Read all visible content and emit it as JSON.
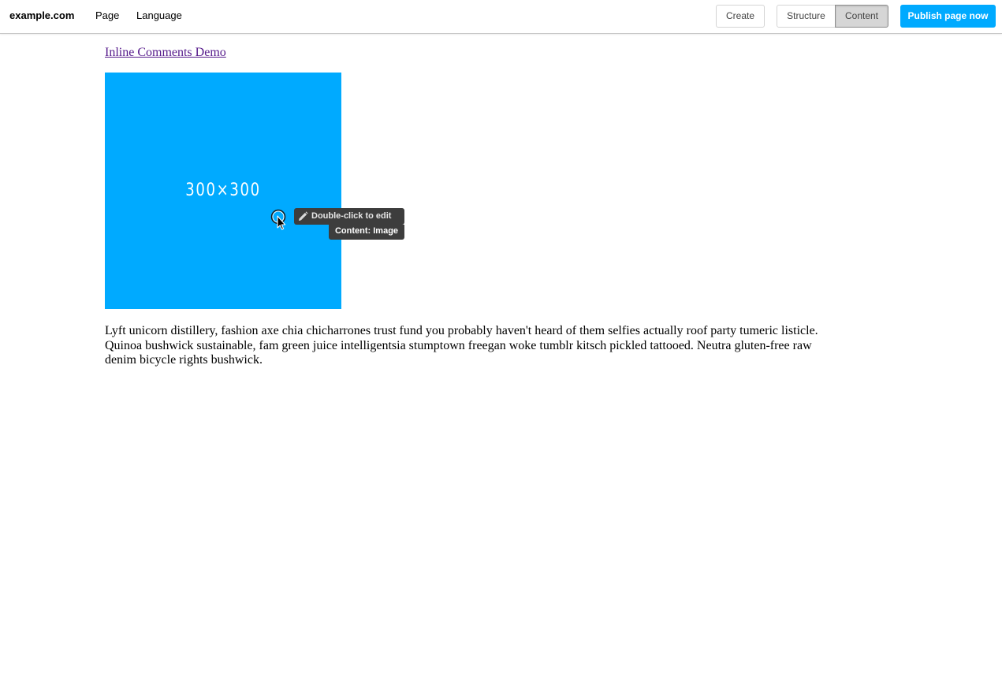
{
  "toolbar": {
    "brand": "example.com",
    "menu": {
      "page": "Page",
      "language": "Language"
    },
    "buttons": {
      "create": "Create",
      "structure": "Structure",
      "content": "Content",
      "publish": "Publish page now"
    },
    "accent_color": "#00aaff"
  },
  "main": {
    "page_link": "Inline Comments Demo",
    "image": {
      "label": "300×300",
      "background_color": "#00aaff"
    },
    "paragraph": "Lyft unicorn distillery, fashion axe chia chicharrones trust fund you probably haven't heard of them selfies actually roof party tumeric listicle. Quinoa bushwick sustainable, fam green juice intelligentsia stumptown freegan woke tumblr kitsch pickled tattooed. Neutra gluten-free raw denim bicycle rights bushwick."
  },
  "tooltip": {
    "action": "Double-click to edit",
    "info": "Content: Image",
    "icon": "pencil-icon"
  },
  "cursor": {
    "icon": "pointer-cursor-icon"
  }
}
